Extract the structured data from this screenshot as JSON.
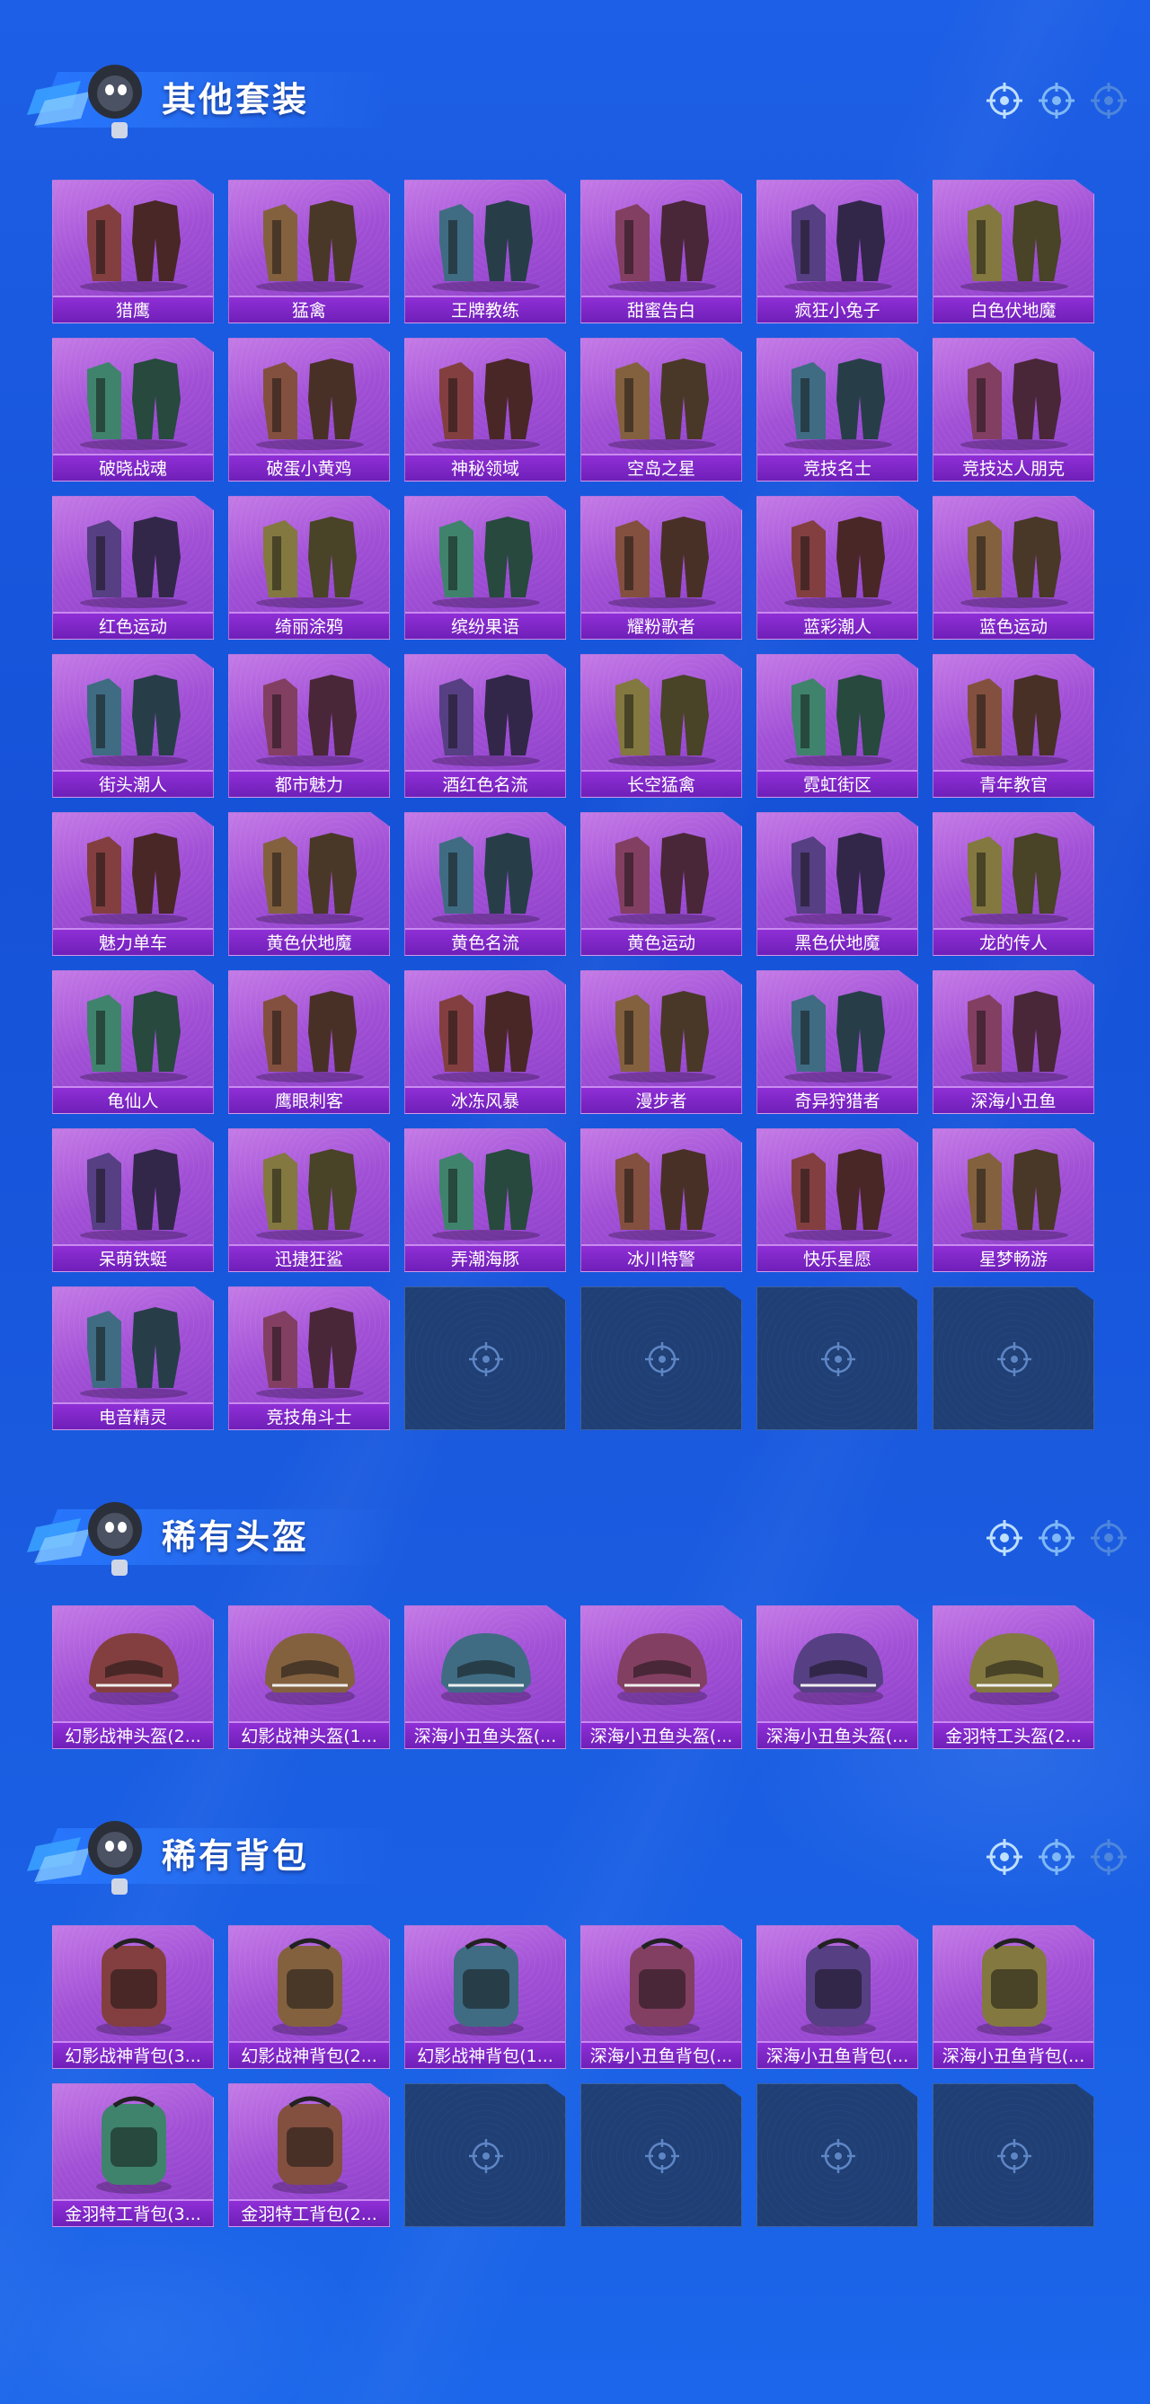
{
  "colors": {
    "tile_top": "#c47ae6",
    "tile_bottom": "#8a3dc8",
    "label_bg": "#7a25c4",
    "empty_slot": "#1f3f75",
    "title_text": "#ffffff"
  },
  "sections": [
    {
      "id": "other-outfits",
      "title": "其他套装",
      "items": [
        {
          "label": "猎鹰",
          "icon": "outfit-icon"
        },
        {
          "label": "猛禽",
          "icon": "outfit-icon"
        },
        {
          "label": "王牌教练",
          "icon": "outfit-icon"
        },
        {
          "label": "甜蜜告白",
          "icon": "outfit-icon"
        },
        {
          "label": "疯狂小兔子",
          "icon": "outfit-icon"
        },
        {
          "label": "白色伏地魔",
          "icon": "outfit-icon"
        },
        {
          "label": "破晓战魂",
          "icon": "outfit-icon"
        },
        {
          "label": "破蛋小黄鸡",
          "icon": "outfit-icon"
        },
        {
          "label": "神秘领域",
          "icon": "outfit-icon"
        },
        {
          "label": "空岛之星",
          "icon": "outfit-icon"
        },
        {
          "label": "竞技名士",
          "icon": "outfit-icon"
        },
        {
          "label": "竞技达人朋克",
          "icon": "outfit-icon"
        },
        {
          "label": "红色运动",
          "icon": "outfit-icon"
        },
        {
          "label": "绮丽涂鸦",
          "icon": "outfit-icon"
        },
        {
          "label": "缤纷果语",
          "icon": "outfit-icon"
        },
        {
          "label": "耀粉歌者",
          "icon": "outfit-icon"
        },
        {
          "label": "蓝彩潮人",
          "icon": "outfit-icon"
        },
        {
          "label": "蓝色运动",
          "icon": "outfit-icon"
        },
        {
          "label": "街头潮人",
          "icon": "outfit-icon"
        },
        {
          "label": "都市魅力",
          "icon": "outfit-icon"
        },
        {
          "label": "酒红色名流",
          "icon": "outfit-icon"
        },
        {
          "label": "长空猛禽",
          "icon": "outfit-icon"
        },
        {
          "label": "霓虹街区",
          "icon": "outfit-icon"
        },
        {
          "label": "青年教官",
          "icon": "outfit-icon"
        },
        {
          "label": "魅力单车",
          "icon": "outfit-icon"
        },
        {
          "label": "黄色伏地魔",
          "icon": "outfit-icon"
        },
        {
          "label": "黄色名流",
          "icon": "outfit-icon"
        },
        {
          "label": "黄色运动",
          "icon": "outfit-icon"
        },
        {
          "label": "黑色伏地魔",
          "icon": "outfit-icon"
        },
        {
          "label": "龙的传人",
          "icon": "outfit-icon"
        },
        {
          "label": "龟仙人",
          "icon": "outfit-icon"
        },
        {
          "label": "鹰眼刺客",
          "icon": "outfit-icon"
        },
        {
          "label": "冰冻风暴",
          "icon": "outfit-icon"
        },
        {
          "label": "漫步者",
          "icon": "outfit-icon"
        },
        {
          "label": "奇异狩猎者",
          "icon": "outfit-icon"
        },
        {
          "label": "深海小丑鱼",
          "icon": "outfit-icon"
        },
        {
          "label": "呆萌铁蜓",
          "icon": "outfit-icon"
        },
        {
          "label": "迅捷狂鲨",
          "icon": "outfit-icon"
        },
        {
          "label": "弄潮海豚",
          "icon": "outfit-icon"
        },
        {
          "label": "冰川特警",
          "icon": "outfit-icon"
        },
        {
          "label": "快乐星愿",
          "icon": "outfit-icon"
        },
        {
          "label": "星梦畅游",
          "icon": "outfit-icon"
        },
        {
          "label": "电音精灵",
          "icon": "outfit-icon"
        },
        {
          "label": "竞技角斗士",
          "icon": "outfit-icon"
        }
      ],
      "empty_slots": 4
    },
    {
      "id": "rare-helmets",
      "title": "稀有头盔",
      "items": [
        {
          "label": "幻影战神头盔(2...",
          "icon": "helmet-icon"
        },
        {
          "label": "幻影战神头盔(1...",
          "icon": "helmet-icon"
        },
        {
          "label": "深海小丑鱼头盔(...",
          "icon": "helmet-icon"
        },
        {
          "label": "深海小丑鱼头盔(...",
          "icon": "helmet-icon"
        },
        {
          "label": "深海小丑鱼头盔(...",
          "icon": "helmet-icon"
        },
        {
          "label": "金羽特工头盔(2...",
          "icon": "helmet-icon"
        }
      ],
      "empty_slots": 0
    },
    {
      "id": "rare-backpacks",
      "title": "稀有背包",
      "items": [
        {
          "label": "幻影战神背包(3...",
          "icon": "backpack-icon"
        },
        {
          "label": "幻影战神背包(2...",
          "icon": "backpack-icon"
        },
        {
          "label": "幻影战神背包(1...",
          "icon": "backpack-icon"
        },
        {
          "label": "深海小丑鱼背包(...",
          "icon": "backpack-icon"
        },
        {
          "label": "深海小丑鱼背包(...",
          "icon": "backpack-icon"
        },
        {
          "label": "深海小丑鱼背包(...",
          "icon": "backpack-icon"
        },
        {
          "label": "金羽特工背包(3...",
          "icon": "backpack-icon"
        },
        {
          "label": "金羽特工背包(2...",
          "icon": "backpack-icon"
        }
      ],
      "empty_slots": 4
    }
  ]
}
